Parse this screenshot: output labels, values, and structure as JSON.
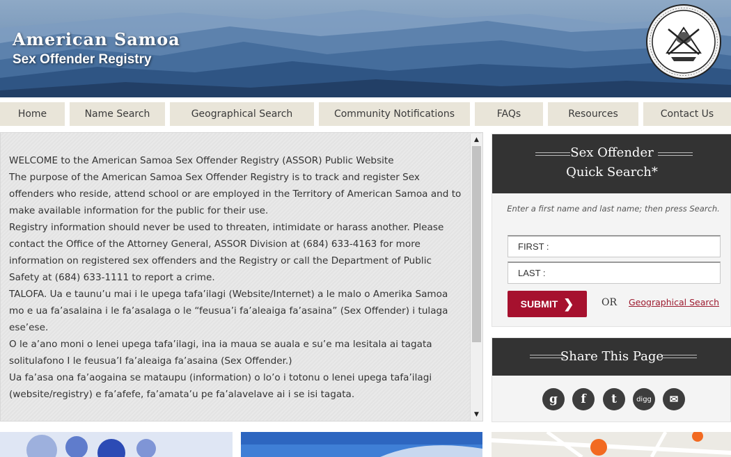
{
  "header": {
    "title": "American Samoa",
    "subtitle": "Sex Offender Registry",
    "seal_icon": "american-samoa-seal"
  },
  "nav": {
    "items": [
      {
        "label": "Home"
      },
      {
        "label": "Name Search"
      },
      {
        "label": "Geographical Search"
      },
      {
        "label": "Community Notifications"
      },
      {
        "label": "FAQs"
      },
      {
        "label": "Resources"
      },
      {
        "label": "Contact Us"
      }
    ]
  },
  "main": {
    "paragraphs": [
      "WELCOME to the American Samoa Sex Offender Registry (ASSOR) Public Website",
      "The purpose of the American Samoa Sex Offender Registry is to track and register Sex offenders who reside, attend school or are employed in the Territory of American Samoa and to make available information for the public for their use.",
      "Registry information should never be used to threaten, intimidate or harass another. Please contact the Office of the Attorney General, ASSOR Division at (684) 633-4163 for more information on registered sex offenders and the Registry or call the Department of Public Safety at (684) 633-1111 to report a crime.",
      "TALOFA. Ua e taunu’u mai i le upega tafa’ilagi (Website/Internet) a le malo o Amerika Samoa mo e ua fa’asalaina i le fa’asalaga o le “feusua’i fa’aleaiga fa’asaina” (Sex Offender) i tulaga ese’ese.",
      "O le a’ano moni o lenei upega tafa’ilagi, ina ia maua se auala e su’e ma lesitala ai tagata solitulafono I le feusua’I fa’aleaiga fa’asaina (Sex Offender.)",
      "Ua fa’asa ona fa’aogaina se mataupu (information) o lo’o i totonu o lenei upega tafa’ilagi (website/registry) e fa’afefe, fa’amata’u pe fa’alavelave ai i se isi tagata."
    ]
  },
  "quick_search": {
    "title_line1": "Sex Offender",
    "title_line2": "Quick Search*",
    "instructions": "Enter a first name and last name; then press Search.",
    "first_placeholder": "FIRST :",
    "last_placeholder": "LAST :",
    "first_value": "",
    "last_value": "",
    "submit_label": "SUBMIT",
    "or_label": "OR",
    "geo_link_label": "Geographical Search",
    "accent_color": "#a6112e"
  },
  "share": {
    "title": "Share This Page",
    "icons": [
      {
        "name": "google-icon",
        "glyph": "g"
      },
      {
        "name": "facebook-icon",
        "glyph": "f"
      },
      {
        "name": "twitter-icon",
        "glyph": "t"
      },
      {
        "name": "digg-icon",
        "glyph": "digg"
      },
      {
        "name": "email-icon",
        "glyph": "✉"
      }
    ]
  }
}
